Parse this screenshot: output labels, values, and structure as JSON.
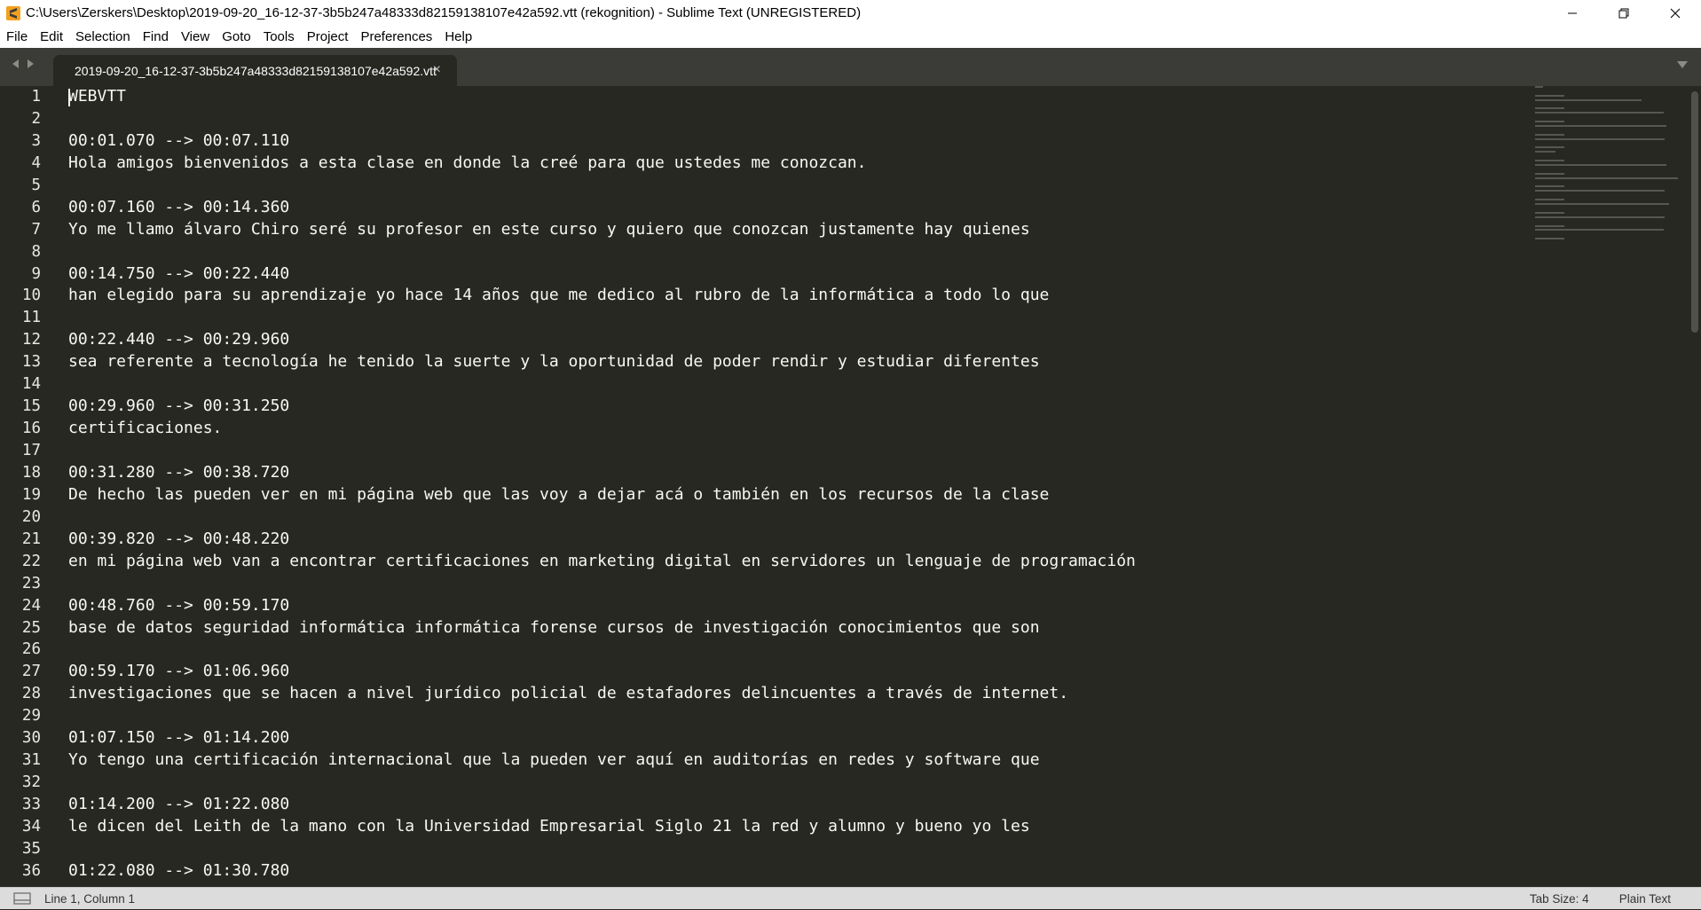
{
  "window": {
    "title": "C:\\Users\\Zerskers\\Desktop\\2019-09-20_16-12-37-3b5b247a48333d82159138107e42a592.vtt (rekognition) - Sublime Text (UNREGISTERED)"
  },
  "menu": [
    "File",
    "Edit",
    "Selection",
    "Find",
    "View",
    "Goto",
    "Tools",
    "Project",
    "Preferences",
    "Help"
  ],
  "tab": {
    "label": "2019-09-20_16-12-37-3b5b247a48333d82159138107e42a592.vtt",
    "close": "×"
  },
  "editor": {
    "line_numbers": [
      "1",
      "2",
      "3",
      "4",
      "5",
      "6",
      "7",
      "8",
      "9",
      "10",
      "11",
      "12",
      "13",
      "14",
      "15",
      "16",
      "17",
      "18",
      "19",
      "20",
      "21",
      "22",
      "23",
      "24",
      "25",
      "26",
      "27",
      "28",
      "29",
      "30",
      "31",
      "32",
      "33",
      "34",
      "35",
      "36"
    ],
    "lines": [
      "WEBVTT",
      "",
      "00:01.070 --> 00:07.110",
      "Hola amigos bienvenidos a esta clase en donde la creé para que ustedes me conozcan.",
      "",
      "00:07.160 --> 00:14.360",
      "Yo me llamo álvaro Chiro seré su profesor en este curso y quiero que conozcan justamente hay quienes",
      "",
      "00:14.750 --> 00:22.440",
      "han elegido para su aprendizaje yo hace 14 años que me dedico al rubro de la informática a todo lo que",
      "",
      "00:22.440 --> 00:29.960",
      "sea referente a tecnología he tenido la suerte y la oportunidad de poder rendir y estudiar diferentes",
      "",
      "00:29.960 --> 00:31.250",
      "certificaciones.",
      "",
      "00:31.280 --> 00:38.720",
      "De hecho las pueden ver en mi página web que las voy a dejar acá o también en los recursos de la clase",
      "",
      "00:39.820 --> 00:48.220",
      "en mi página web van a encontrar certificaciones en marketing digital en servidores un lenguaje de programación",
      "",
      "00:48.760 --> 00:59.170",
      "base de datos seguridad informática informática forense cursos de investigación conocimientos que son",
      "",
      "00:59.170 --> 01:06.960",
      "investigaciones que se hacen a nivel jurídico policial de estafadores delincuentes a través de internet.",
      "",
      "01:07.150 --> 01:14.200",
      "Yo tengo una certificación internacional que la pueden ver aquí en auditorías en redes y software que",
      "",
      "01:14.200 --> 01:22.080",
      "le dicen del Leith de la mano con la Universidad Empresarial Siglo 21 la red y alumno y bueno yo les",
      "",
      "01:22.080 --> 01:30.780"
    ]
  },
  "status": {
    "position": "Line 1, Column 1",
    "tab_size": "Tab Size: 4",
    "syntax": "Plain Text"
  },
  "icons": {
    "app": "sublime-text-icon",
    "minimize": "minimize-icon",
    "maximize": "restore-icon",
    "close": "close-icon",
    "nav_left": "arrow-left-icon",
    "nav_right": "arrow-right-icon",
    "tab_dropdown": "chevron-down-icon",
    "status_panel": "panel-toggle-icon"
  },
  "colors": {
    "editor_bg": "#272822",
    "text": "#f8f8f2",
    "tabbar_bg": "#3b3c37",
    "statusbar_bg": "#dcdcdc",
    "app_icon": "#f3a01f"
  }
}
